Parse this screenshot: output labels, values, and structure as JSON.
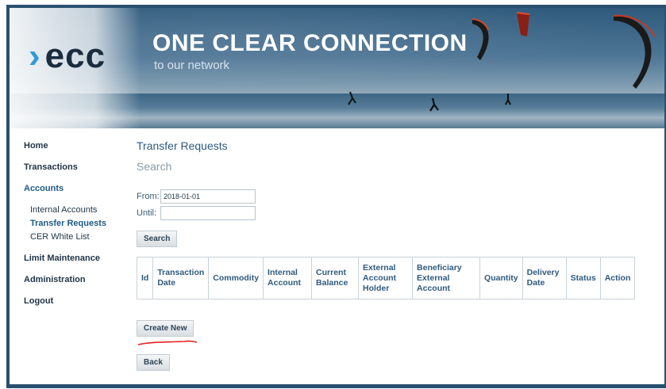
{
  "header": {
    "logo_chevron": "›",
    "logo_text": "ecc",
    "tagline": "ONE CLEAR CONNECTION",
    "subtagline": "to our network"
  },
  "sidebar": {
    "items": [
      {
        "label": "Home"
      },
      {
        "label": "Transactions"
      },
      {
        "label": "Accounts"
      },
      {
        "label": "Limit Maintenance"
      },
      {
        "label": "Administration"
      },
      {
        "label": "Logout"
      }
    ],
    "accounts_sub": [
      {
        "label": "Internal Accounts"
      },
      {
        "label": "Transfer Requests"
      },
      {
        "label": "CER White List"
      }
    ]
  },
  "main": {
    "page_title": "Transfer Requests",
    "section_title": "Search",
    "from_label": "From:",
    "from_value": "2018-01-01",
    "until_label": "Until:",
    "until_value": "",
    "search_button": "Search",
    "create_button": "Create New",
    "back_button": "Back",
    "table_headers": [
      "Id",
      "Transaction Date",
      "Commodity",
      "Internal Account",
      "Current Balance",
      "External Account Holder",
      "Beneficiary External Account",
      "Quantity",
      "Delivery Date",
      "Status",
      "Action"
    ]
  },
  "colors": {
    "frame": "#2a5070",
    "accent_blue": "#2e9bd6",
    "link_blue": "#2d5a7e",
    "annotation_red": "#e02020"
  }
}
